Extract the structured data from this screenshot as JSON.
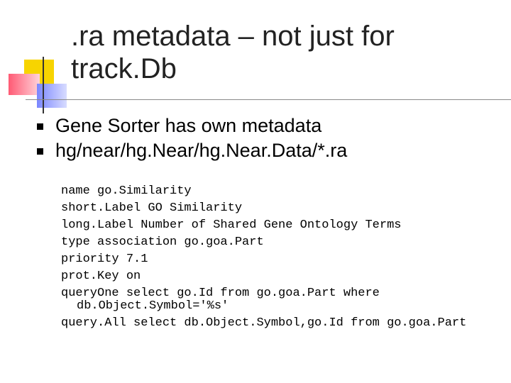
{
  "slide": {
    "title": ".ra metadata – not just for track.Db",
    "bullets": [
      "Gene Sorter has own metadata",
      "hg/near/hg.Near/hg.Near.Data/*.ra"
    ],
    "code_lines": [
      "name go.Similarity",
      "short.Label GO Similarity",
      "long.Label Number of Shared Gene Ontology Terms",
      "type association go.goa.Part",
      "priority 7.1",
      "prot.Key on",
      "queryOne select go.Id from go.goa.Part where",
      "db.Object.Symbol='%s'",
      "query.All select db.Object.Symbol,go.Id from go.goa.Part"
    ]
  },
  "colors": {
    "logo_yellow": "#f7d400",
    "logo_red": "#ff5a74",
    "logo_blue": "#7a86ff",
    "rule": "#8a8a8a"
  },
  "icons": {
    "bullet": "square-bullet-icon",
    "logo": "color-squares-logo"
  }
}
